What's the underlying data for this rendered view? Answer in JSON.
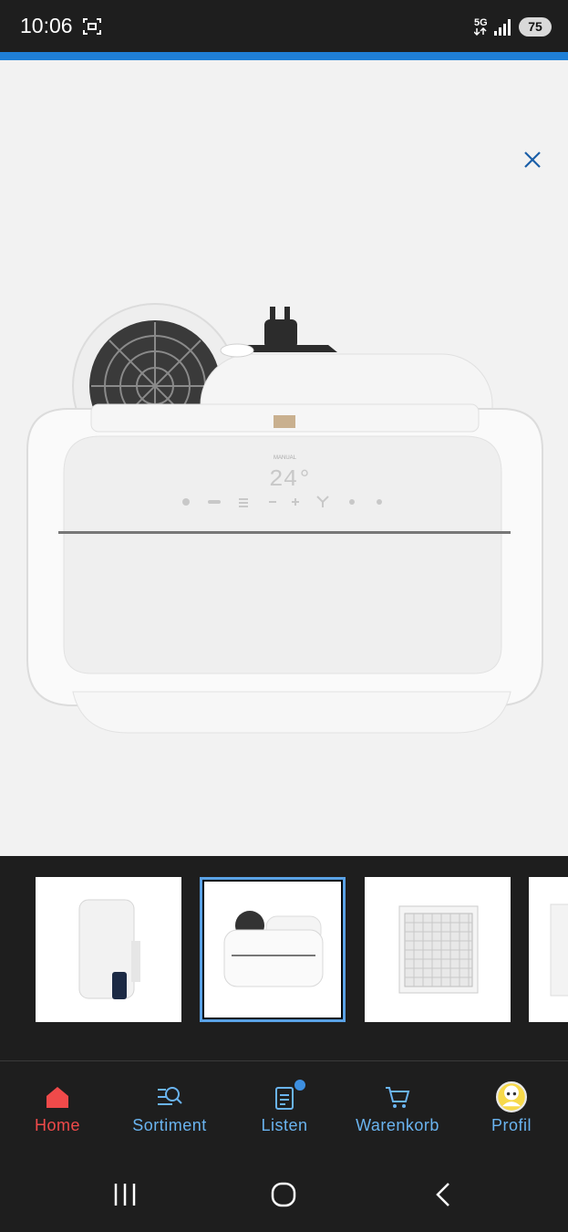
{
  "status_bar": {
    "time": "10:06",
    "network": "5G",
    "battery": "75"
  },
  "viewer": {
    "close_icon": "close-icon",
    "image_icon": "portable-air-conditioner-top-view",
    "display_reading": "24°",
    "display_caption": "MANUAL"
  },
  "thumbnails": [
    {
      "name": "thumb-front-view",
      "selected": false
    },
    {
      "name": "thumb-top-view",
      "selected": true
    },
    {
      "name": "thumb-filter-view",
      "selected": false
    },
    {
      "name": "thumb-side-view",
      "selected": false
    }
  ],
  "bottom_nav": {
    "items": [
      {
        "label": "Home",
        "icon": "home-icon",
        "active": true
      },
      {
        "label": "Sortiment",
        "icon": "search-list-icon",
        "active": false
      },
      {
        "label": "Listen",
        "icon": "clipboard-icon",
        "active": false,
        "badge": true
      },
      {
        "label": "Warenkorb",
        "icon": "cart-icon",
        "active": false
      },
      {
        "label": "Profil",
        "icon": "profile-avatar-icon",
        "active": false
      }
    ]
  },
  "colors": {
    "accent": "#1f7fd6",
    "active_nav": "#f04a4a",
    "nav_label": "#6ab4f0",
    "dark_bg": "#1e1e1e"
  }
}
